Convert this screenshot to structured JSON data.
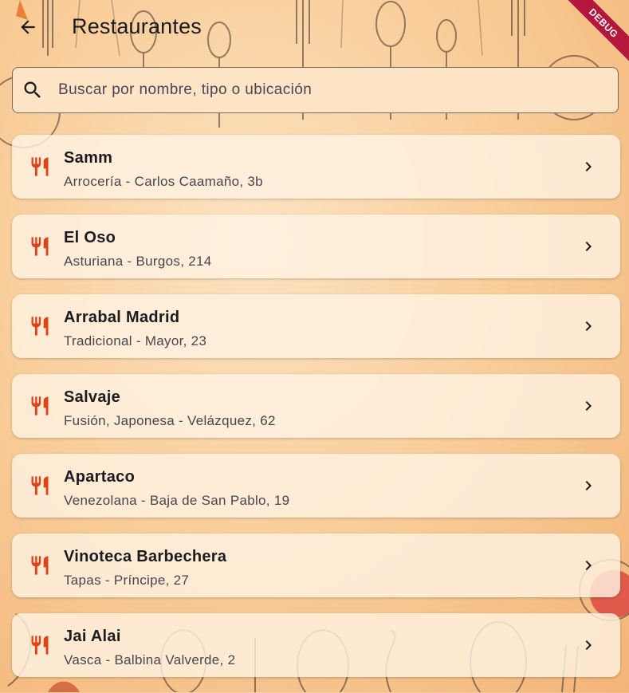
{
  "app_bar": {
    "title": "Restaurantes",
    "back_icon": "arrow-back-icon",
    "debug_label": "DEBUG"
  },
  "search": {
    "placeholder": "Buscar por nombre, tipo o ubicación",
    "value": "",
    "icon": "search-icon"
  },
  "restaurants": [
    {
      "name": "Samm",
      "subtitle": "Arrocería - Carlos Caamaño, 3b"
    },
    {
      "name": "El Oso",
      "subtitle": "Asturiana - Burgos, 214"
    },
    {
      "name": "Arrabal Madrid",
      "subtitle": "Tradicional - Mayor, 23"
    },
    {
      "name": "Salvaje",
      "subtitle": "Fusión, Japonesa - Velázquez, 62"
    },
    {
      "name": "Apartaco",
      "subtitle": "Venezolana - Baja de San Pablo, 19"
    },
    {
      "name": "Vinoteca Barbechera",
      "subtitle": "Tapas - Príncipe, 27"
    },
    {
      "name": "Jai Alai",
      "subtitle": "Vasca - Balbina Valverde, 2"
    }
  ],
  "icons": {
    "list_leading": "restaurant-icon",
    "list_trailing": "chevron-right-icon"
  },
  "colors": {
    "accent": "#e0431a",
    "background": "#f9cf9c",
    "debug_banner": "#b5163b"
  }
}
